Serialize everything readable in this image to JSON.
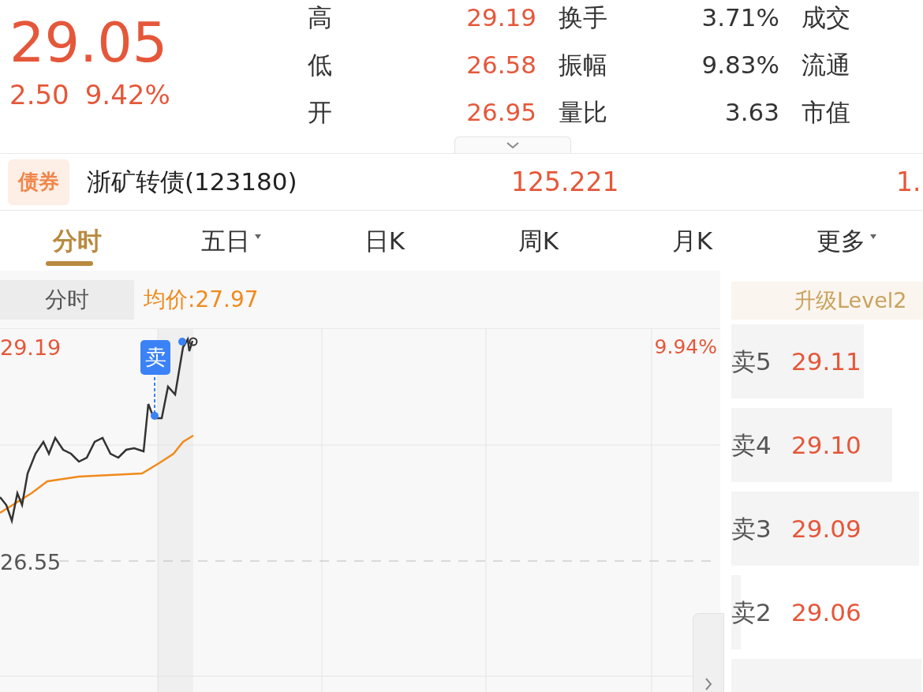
{
  "quote": {
    "price": "29.05",
    "change": "2.50",
    "change_pct": "9.42%"
  },
  "stats": [
    {
      "label": "高",
      "value": "29.19",
      "label_2": "换手",
      "value_2": "3.71%",
      "label_3": "成交"
    },
    {
      "label": "低",
      "value": "26.58",
      "label_2": "振幅",
      "value_2": "9.83%",
      "label_3": "流通"
    },
    {
      "label": "开",
      "value": "26.95",
      "label_2": "量比",
      "value_2": "3.63",
      "label_3": "市值"
    }
  ],
  "bond": {
    "badge": "债券",
    "name": "浙矿转债(123180)",
    "price": "125.221",
    "column_3": "1."
  },
  "tabs": [
    {
      "label": "分时",
      "selected": true,
      "dropdown": false
    },
    {
      "label": "五日",
      "selected": false,
      "dropdown": true
    },
    {
      "label": "日K",
      "selected": false,
      "dropdown": false
    },
    {
      "label": "周K",
      "selected": false,
      "dropdown": false
    },
    {
      "label": "月K",
      "selected": false,
      "dropdown": false
    },
    {
      "label": "更多",
      "selected": false,
      "dropdown": true
    }
  ],
  "chart": {
    "mode_button": "分时",
    "avg_label": "均价:27.97",
    "high_label": "29.19",
    "base_label": "26.55",
    "pct_label": "9.94%",
    "marker": "卖"
  },
  "order_book": {
    "banner": "升级Level2",
    "orders": [
      {
        "label": "卖5",
        "price": "29.11",
        "level": 0.69
      },
      {
        "label": "卖4",
        "price": "29.10",
        "level": 0.84
      },
      {
        "label": "卖3",
        "price": "29.09",
        "level": 0.98
      },
      {
        "label": "卖2",
        "price": "29.06",
        "level": 0.05
      },
      {
        "level": 0.99
      }
    ]
  }
}
